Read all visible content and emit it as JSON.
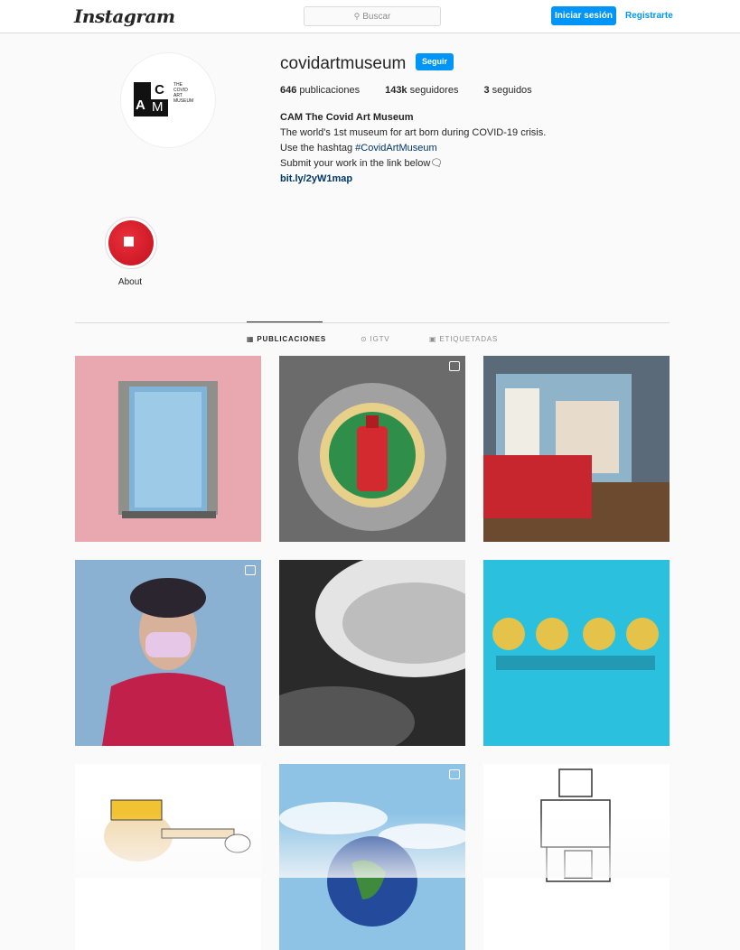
{
  "header": {
    "logo": "Instagram",
    "search_placeholder": "Buscar",
    "login_label": "Iniciar sesión",
    "signup_label": "Registrarte"
  },
  "profile": {
    "username": "covidartmuseum",
    "follow_label": "Seguir",
    "avatar_text": {
      "a": "A",
      "c": "C",
      "m": "M",
      "line1": "THE",
      "line2": "COVID",
      "line3": "ART",
      "line4": "MUSEUM"
    },
    "stats": {
      "posts_count": "646",
      "posts_label": "publicaciones",
      "followers_count": "143k",
      "followers_label": "seguidores",
      "following_count": "3",
      "following_label": "seguidos"
    },
    "bio": {
      "name": "CAM The Covid Art Museum",
      "line1": "The world's 1st museum for art born during COVID-19 crisis.",
      "line2_prefix": "Use the hashtag ",
      "hashtag": "#CovidArtMuseum",
      "line3": "Submit your work in the link below🗨",
      "link": "bit.ly/2yW1map"
    }
  },
  "highlights": [
    {
      "label": "About"
    }
  ],
  "tabs": [
    {
      "label": "PUBLICACIONES",
      "icon": "grid-icon",
      "active": true
    },
    {
      "label": "IGTV",
      "icon": "igtv-icon",
      "active": false
    },
    {
      "label": "ETIQUETADAS",
      "icon": "tagged-icon",
      "active": false
    }
  ],
  "posts": [
    {
      "subject": "mask-napkin-dispenser",
      "badge": "none"
    },
    {
      "subject": "hand-sanitizer-mosaic",
      "badge": "multi-photo-icon"
    },
    {
      "subject": "window-house-figure",
      "badge": "none"
    },
    {
      "subject": "frida-with-mask",
      "badge": "video-icon"
    },
    {
      "subject": "hat-black-white",
      "badge": "none"
    },
    {
      "subject": "2020-sad-faces",
      "badge": "none"
    },
    {
      "subject": "pinocchio-cartoon",
      "badge": "none"
    },
    {
      "subject": "earth-in-sky",
      "badge": "video-icon"
    },
    {
      "subject": "floor-plan-drawing",
      "badge": "none"
    }
  ],
  "colors": {
    "accent": "#0095f6",
    "link": "#00376b",
    "highlight": "#d81f2a"
  }
}
